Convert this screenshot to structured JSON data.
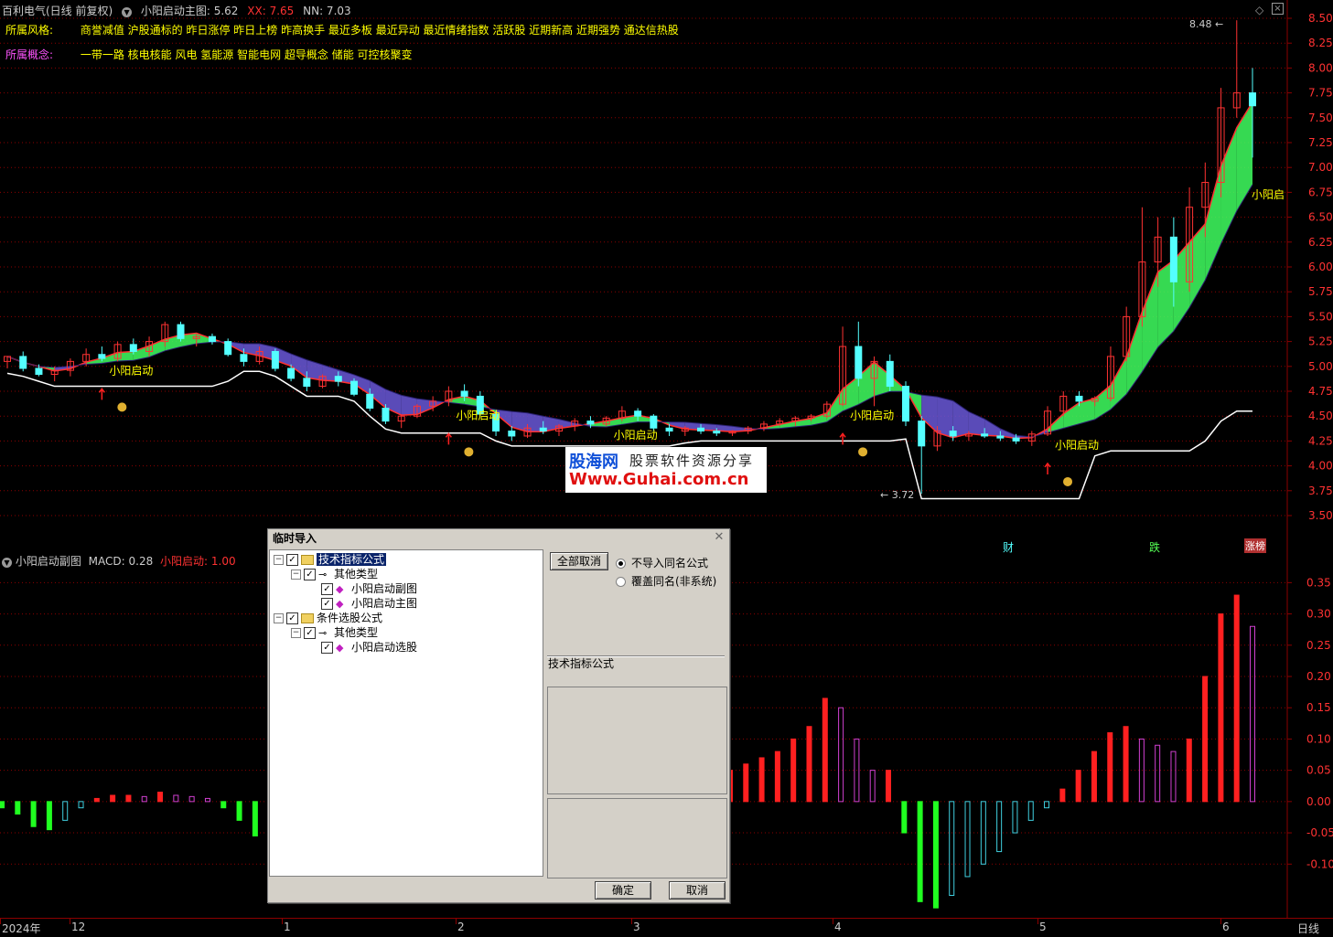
{
  "header": {
    "stock": "百利电气(日线 前复权)",
    "indicator": "小阳启动主图",
    "value": ": 5.62",
    "xx": "XX: 7.65",
    "nn": "NN: 7.03"
  },
  "info": {
    "style_label": "所属风格:",
    "style_text": "商誉减值 沪股通标的 昨日涨停 昨日上榜 昨高换手 最近多板 最近异动 最近情绪指数 活跃股 近期新高 近期强势 通达信热股",
    "concept_label": "所属概念:",
    "concept_text": "一带一路 核电核能 风电 氢能源 智能电网 超导概念 储能 可控核聚变"
  },
  "colors": {
    "up": "#ff3232",
    "down": "#54ffff",
    "grid": "#8b0000",
    "label_yellow": "#ffff00",
    "label_magenta": "#ff54ff"
  },
  "main_axis": {
    "ticks": [
      "8.50",
      "8.25",
      "8.00",
      "7.75",
      "7.50",
      "7.25",
      "7.00",
      "6.75",
      "6.50",
      "6.25",
      "6.00",
      "5.75",
      "5.50",
      "5.25",
      "5.00",
      "4.75",
      "4.50",
      "4.25",
      "4.00",
      "3.75",
      "3.50"
    ]
  },
  "sub_axis": {
    "ticks": [
      "0.35",
      "0.30",
      "0.25",
      "0.20",
      "0.15",
      "0.10",
      "0.05",
      "0.00",
      "-0.05",
      "-0.10"
    ]
  },
  "annotations": {
    "high_label": "8.48",
    "low_label": "3.72",
    "signal_text": "小阳启动",
    "signal_text_cut": "小阳启",
    "events": [
      "财",
      "跌",
      "涨榜"
    ]
  },
  "watermark": {
    "brand": "股海网",
    "slogan": "股票软件资源分享",
    "url": "Www.Guhai.com.cn"
  },
  "sub_header": {
    "title": "小阳启动副图",
    "macd": "MACD: 0.28",
    "signal": "小阳启动: 1.00"
  },
  "time_axis": {
    "labels": [
      "2024年",
      "12",
      "1",
      "2",
      "3",
      "4",
      "5",
      "6"
    ],
    "period": "日线"
  },
  "dialog": {
    "title": "临时导入",
    "tree": [
      {
        "label": "技术指标公式",
        "level": 0,
        "kind": "folder",
        "selected": true
      },
      {
        "label": "其他类型",
        "level": 1,
        "kind": "key"
      },
      {
        "label": "小阳启动副图",
        "level": 2,
        "kind": "gem"
      },
      {
        "label": "小阳启动主图",
        "level": 2,
        "kind": "gem"
      },
      {
        "label": "条件选股公式",
        "level": 0,
        "kind": "folder"
      },
      {
        "label": "其他类型",
        "level": 1,
        "kind": "key"
      },
      {
        "label": "小阳启动选股",
        "level": 2,
        "kind": "gem"
      }
    ],
    "deselect_all": "全部取消",
    "radio_skip": "不导入同名公式",
    "radio_overwrite": "覆盖同名(非系统)",
    "section": "技术指标公式",
    "ok": "确定",
    "cancel": "取消"
  },
  "chart_data": {
    "type": "candlestick",
    "ylim": [
      3.4,
      8.6
    ],
    "sub_ylim": [
      -0.18,
      0.39
    ],
    "candles": [
      [
        5.05,
        5.1,
        4.98,
        5.1,
        1
      ],
      [
        5.1,
        5.15,
        4.95,
        4.98,
        -1
      ],
      [
        4.98,
        5.02,
        4.9,
        4.92,
        -1
      ],
      [
        4.92,
        5.0,
        4.85,
        4.96,
        1
      ],
      [
        4.96,
        5.08,
        4.9,
        5.05,
        1
      ],
      [
        5.05,
        5.18,
        5.0,
        5.12,
        1
      ],
      [
        5.12,
        5.2,
        5.05,
        5.08,
        -1
      ],
      [
        5.08,
        5.25,
        5.05,
        5.22,
        1
      ],
      [
        5.22,
        5.28,
        5.12,
        5.15,
        -1
      ],
      [
        5.15,
        5.3,
        5.1,
        5.25,
        1
      ],
      [
        5.25,
        5.45,
        5.2,
        5.42,
        1
      ],
      [
        5.42,
        5.45,
        5.25,
        5.28,
        -1
      ],
      [
        5.28,
        5.32,
        5.2,
        5.3,
        1
      ],
      [
        5.3,
        5.33,
        5.22,
        5.25,
        -1
      ],
      [
        5.25,
        5.28,
        5.1,
        5.12,
        -1
      ],
      [
        5.12,
        5.18,
        5.0,
        5.05,
        -1
      ],
      [
        5.05,
        5.2,
        5.02,
        5.15,
        1
      ],
      [
        5.15,
        5.18,
        4.95,
        4.98,
        -1
      ],
      [
        4.98,
        5.02,
        4.85,
        4.88,
        -1
      ],
      [
        4.88,
        4.95,
        4.75,
        4.8,
        -1
      ],
      [
        4.8,
        4.92,
        4.78,
        4.9,
        1
      ],
      [
        4.9,
        4.95,
        4.8,
        4.85,
        -1
      ],
      [
        4.85,
        4.88,
        4.7,
        4.72,
        -1
      ],
      [
        4.72,
        4.78,
        4.55,
        4.58,
        -1
      ],
      [
        4.58,
        4.62,
        4.42,
        4.45,
        -1
      ],
      [
        4.45,
        4.52,
        4.38,
        4.5,
        1
      ],
      [
        4.5,
        4.62,
        4.48,
        4.6,
        1
      ],
      [
        4.6,
        4.7,
        4.55,
        4.65,
        1
      ],
      [
        4.65,
        4.8,
        4.6,
        4.75,
        1
      ],
      [
        4.75,
        4.82,
        4.65,
        4.7,
        -1
      ],
      [
        4.7,
        4.75,
        4.5,
        4.52,
        -1
      ],
      [
        4.52,
        4.55,
        4.3,
        4.35,
        -1
      ],
      [
        4.35,
        4.4,
        4.25,
        4.3,
        -1
      ],
      [
        4.3,
        4.42,
        4.28,
        4.38,
        1
      ],
      [
        4.38,
        4.45,
        4.32,
        4.35,
        -1
      ],
      [
        4.35,
        4.42,
        4.3,
        4.4,
        1
      ],
      [
        4.4,
        4.48,
        4.35,
        4.45,
        1
      ],
      [
        4.45,
        4.5,
        4.38,
        4.42,
        -1
      ],
      [
        4.42,
        4.5,
        4.4,
        4.48,
        1
      ],
      [
        4.48,
        4.6,
        4.45,
        4.55,
        1
      ],
      [
        4.55,
        4.58,
        4.45,
        4.5,
        -1
      ],
      [
        4.5,
        4.52,
        4.35,
        4.38,
        -1
      ],
      [
        4.38,
        4.42,
        4.3,
        4.35,
        -1
      ],
      [
        4.35,
        4.4,
        4.3,
        4.38,
        1
      ],
      [
        4.38,
        4.42,
        4.32,
        4.35,
        -1
      ],
      [
        4.35,
        4.38,
        4.3,
        4.33,
        -1
      ],
      [
        4.33,
        4.36,
        4.3,
        4.35,
        1
      ],
      [
        4.35,
        4.4,
        4.32,
        4.38,
        1
      ],
      [
        4.38,
        4.45,
        4.35,
        4.42,
        1
      ],
      [
        4.42,
        4.48,
        4.4,
        4.45,
        1
      ],
      [
        4.45,
        4.5,
        4.4,
        4.48,
        1
      ],
      [
        4.48,
        4.52,
        4.45,
        4.5,
        1
      ],
      [
        4.5,
        4.65,
        4.48,
        4.62,
        1
      ],
      [
        4.62,
        5.4,
        4.6,
        5.2,
        1
      ],
      [
        5.2,
        5.45,
        4.8,
        4.88,
        -1
      ],
      [
        4.88,
        5.1,
        4.6,
        5.05,
        1
      ],
      [
        5.05,
        5.12,
        4.75,
        4.8,
        -1
      ],
      [
        4.8,
        4.85,
        4.4,
        4.45,
        -1
      ],
      [
        4.45,
        4.5,
        3.72,
        4.2,
        -1
      ],
      [
        4.2,
        4.4,
        4.15,
        4.35,
        1
      ],
      [
        4.35,
        4.4,
        4.25,
        4.3,
        -1
      ],
      [
        4.3,
        4.35,
        4.25,
        4.32,
        1
      ],
      [
        4.32,
        4.38,
        4.28,
        4.3,
        -1
      ],
      [
        4.3,
        4.35,
        4.25,
        4.28,
        -1
      ],
      [
        4.28,
        4.32,
        4.22,
        4.25,
        -1
      ],
      [
        4.25,
        4.35,
        4.2,
        4.32,
        1
      ],
      [
        4.32,
        4.6,
        4.3,
        4.55,
        1
      ],
      [
        4.55,
        4.75,
        4.5,
        4.7,
        1
      ],
      [
        4.7,
        4.75,
        4.6,
        4.65,
        -1
      ],
      [
        4.65,
        4.7,
        4.6,
        4.68,
        1
      ],
      [
        4.68,
        5.2,
        4.65,
        5.1,
        1
      ],
      [
        5.1,
        5.6,
        5.05,
        5.5,
        1
      ],
      [
        5.5,
        6.6,
        5.4,
        6.05,
        -1
      ],
      [
        6.05,
        6.5,
        5.8,
        6.3,
        1
      ],
      [
        6.3,
        6.5,
        5.6,
        5.85,
        -1
      ],
      [
        5.85,
        6.8,
        5.75,
        6.6,
        1
      ],
      [
        6.6,
        7.05,
        6.3,
        6.85,
        1
      ],
      [
        6.85,
        7.8,
        6.7,
        7.6,
        1
      ],
      [
        7.6,
        8.48,
        7.5,
        7.75,
        -1
      ],
      [
        7.75,
        8.0,
        7.1,
        7.62,
        -1
      ]
    ],
    "macd": [
      -0.01,
      -0.02,
      -0.04,
      -0.045,
      -0.03,
      -0.01,
      0.005,
      0.01,
      0.01,
      0.008,
      0.015,
      0.01,
      0.008,
      0.005,
      -0.01,
      -0.03,
      -0.055,
      -0.06,
      -0.07,
      -0.09,
      -0.1,
      -0.105,
      -0.12,
      -0.1,
      -0.08,
      -0.06,
      -0.04,
      -0.03,
      -0.02,
      -0.01,
      -0.005,
      0.0,
      0.01,
      0.02,
      0.045,
      0.05,
      0.045,
      0.05,
      0.045,
      0.05,
      0.08,
      0.09,
      0.075,
      0.06,
      0.05,
      0.04,
      0.05,
      0.06,
      0.07,
      0.08,
      0.1,
      0.12,
      0.165,
      0.15,
      0.1,
      0.05,
      0.05,
      -0.05,
      -0.16,
      -0.17,
      -0.15,
      -0.12,
      -0.1,
      -0.08,
      -0.05,
      -0.03,
      -0.01,
      0.02,
      0.05,
      0.08,
      0.11,
      0.12,
      0.1,
      0.09,
      0.08,
      0.1,
      0.2,
      0.3,
      0.33,
      0.28
    ]
  }
}
